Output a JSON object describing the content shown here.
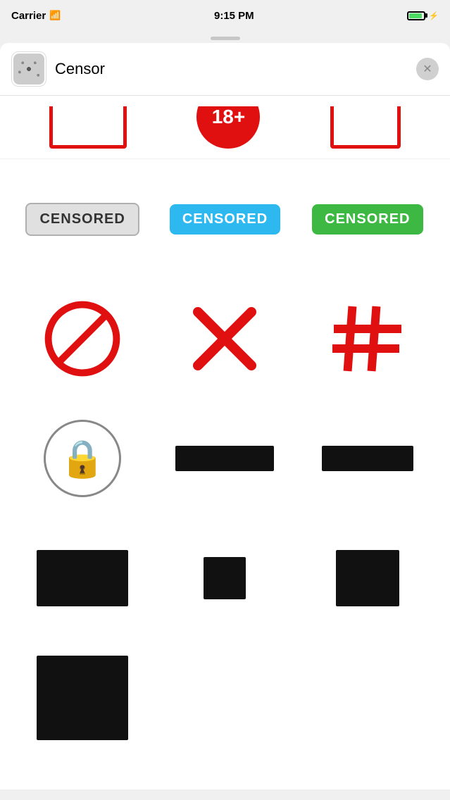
{
  "status_bar": {
    "carrier": "Carrier",
    "time": "9:15 PM",
    "battery_label": "battery"
  },
  "header": {
    "app_name": "Censor",
    "close_label": "✕"
  },
  "top_row": {
    "items": [
      {
        "type": "red_border_rect",
        "label": "red border rect"
      },
      {
        "type": "red_circle_number",
        "text": "18+",
        "label": "18 plus circle"
      },
      {
        "type": "red_rect_outline",
        "label": "red rect outline"
      }
    ]
  },
  "stickers": {
    "row1": [
      {
        "id": "censored-gray",
        "type": "censored_button",
        "variant": "gray",
        "label": "CENSORED"
      },
      {
        "id": "censored-blue",
        "type": "censored_button",
        "variant": "blue",
        "label": "CENSORED"
      },
      {
        "id": "censored-green",
        "type": "censored_button",
        "variant": "green",
        "label": "CENSORED"
      }
    ],
    "row2": [
      {
        "id": "no-symbol",
        "type": "no_symbol",
        "label": "no symbol"
      },
      {
        "id": "x-mark",
        "type": "x_mark",
        "label": "X mark"
      },
      {
        "id": "hash-symbol",
        "type": "hash_symbol",
        "label": "hash symbol"
      }
    ],
    "row3": [
      {
        "id": "lock-circle",
        "type": "lock_circle",
        "label": "lock in circle"
      },
      {
        "id": "black-bar-wide",
        "type": "black_bar_wide",
        "label": "black bar wide"
      },
      {
        "id": "black-bar-medium",
        "type": "black_bar_medium",
        "label": "black bar medium"
      }
    ],
    "row4": [
      {
        "id": "black-rect-large",
        "type": "black_rect_large",
        "label": "black rectangle large"
      },
      {
        "id": "black-rect-small",
        "type": "black_rect_small",
        "label": "black rectangle small"
      },
      {
        "id": "black-rect-med",
        "type": "black_rect_med",
        "label": "black rectangle medium"
      }
    ],
    "row5": [
      {
        "id": "black-rect-tall",
        "type": "black_rect_tall",
        "label": "black rectangle tall"
      }
    ]
  },
  "colors": {
    "red": "#e01010",
    "blue": "#2db8f0",
    "green": "#3cb843",
    "gray_bg": "#e0e0e0",
    "black": "#111111"
  }
}
